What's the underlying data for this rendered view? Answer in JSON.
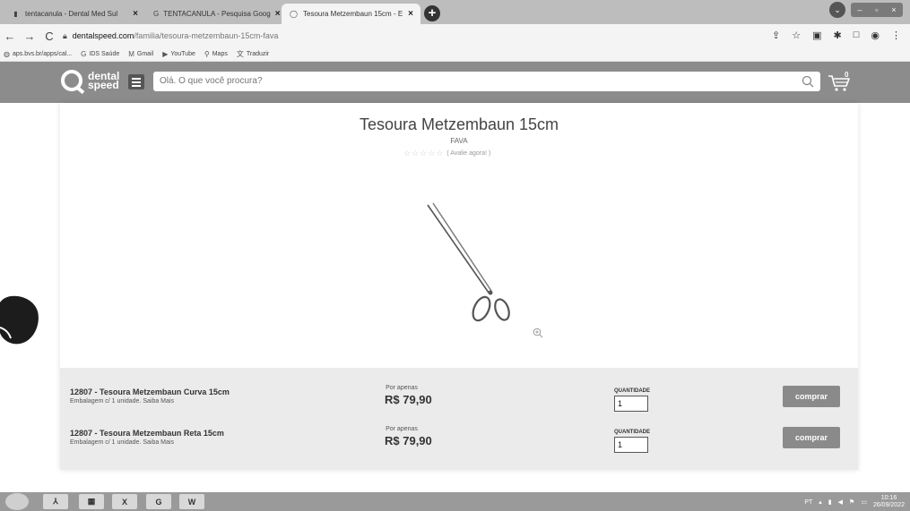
{
  "browser": {
    "tabs": [
      {
        "title": "tentacanula - Dental Med Sul",
        "icon": "tab-site-icon",
        "active": false
      },
      {
        "title": "TENTACANULA - Pesquisa Goog",
        "icon": "google-icon",
        "active": false
      },
      {
        "title": "Tesoura Metzembaun 15cm - E",
        "icon": "loading-icon",
        "active": true
      }
    ],
    "new_tab": "+",
    "url_domain": "dentalspeed.com",
    "url_path": "/familia/tesoura-metzembaun-15cm-fava",
    "bookmarks": [
      {
        "label": "aps.bvs.br/apps/cal...",
        "icon": "globe-icon"
      },
      {
        "label": "IDS Saúde",
        "icon": "google-icon"
      },
      {
        "label": "Gmail",
        "icon": "gmail-icon"
      },
      {
        "label": "YouTube",
        "icon": "youtube-icon"
      },
      {
        "label": "Maps",
        "icon": "maps-icon"
      },
      {
        "label": "Traduzir",
        "icon": "translate-icon"
      }
    ]
  },
  "site": {
    "logo_line1": "dental",
    "logo_line2": "speed",
    "search_placeholder": "Olá. O que você procura?",
    "cart_count": "0"
  },
  "product": {
    "title": "Tesoura Metzembaun 15cm",
    "brand": "FAVA",
    "stars": "☆☆☆☆☆",
    "rating_cta": "( Avalie agora! )",
    "rating_value": 0,
    "variants": [
      {
        "name": "12807 - Tesoura Metzembaun Curva 15cm",
        "pack": "Embalagem c/ 1 unidade. Saiba Mais",
        "price_label": "Por apenas",
        "price": "R$ 79,90",
        "qty_label": "QUANTIDADE",
        "qty": "1",
        "buy_label": "comprar"
      },
      {
        "name": "12807 - Tesoura Metzembaun Reta 15cm",
        "pack": "Embalagem c/ 1 unidade. Saiba Mais",
        "price_label": "Por apenas",
        "price": "R$ 79,90",
        "qty_label": "QUANTIDADE",
        "qty": "1",
        "buy_label": "comprar"
      }
    ]
  },
  "taskbar": {
    "lang": "PT",
    "time": "10:16",
    "date": "26/09/2022"
  }
}
